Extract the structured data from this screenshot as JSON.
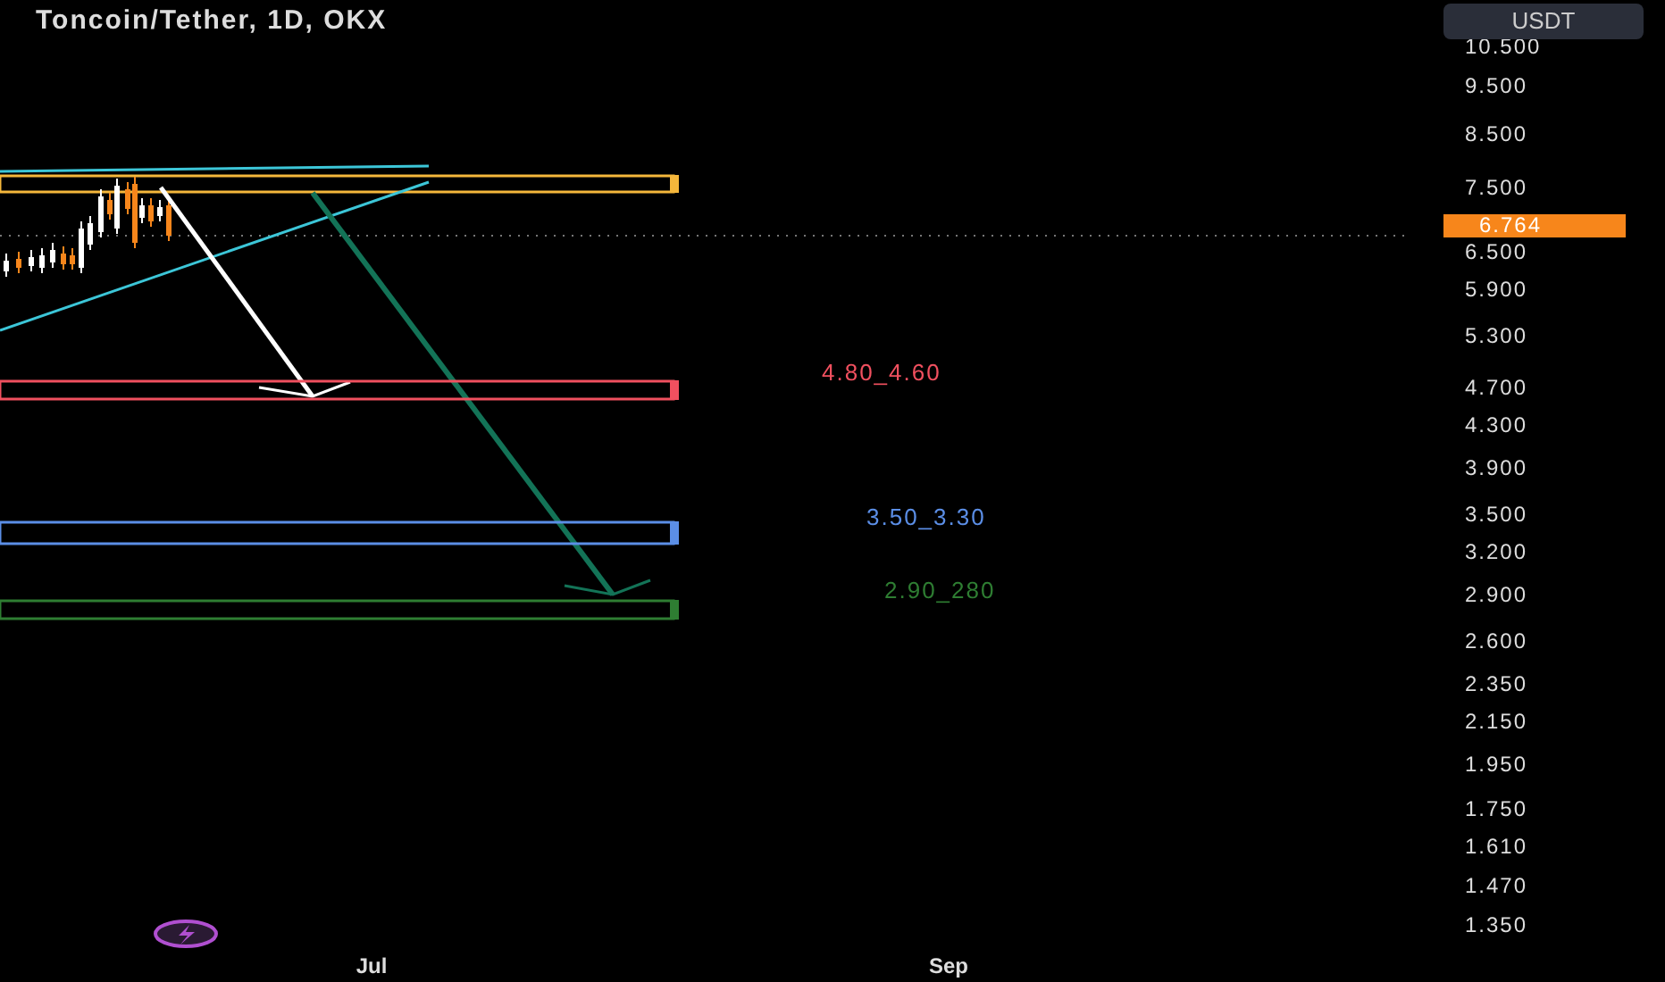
{
  "header": {
    "title": "Toncoin/Tether, 1D, OKX"
  },
  "currency_button": {
    "label": "USDT"
  },
  "price_axis": {
    "labels": [
      "10.500",
      "9.500",
      "8.500",
      "7.500",
      "6.500",
      "5.900",
      "5.300",
      "4.700",
      "4.300",
      "3.900",
      "3.500",
      "3.200",
      "2.900",
      "2.600",
      "2.350",
      "2.150",
      "1.950",
      "1.750",
      "1.610",
      "1.470",
      "1.350"
    ],
    "current_price": "6.764"
  },
  "zones": [
    {
      "label": "4.80_4.60",
      "color": "#f0505f"
    },
    {
      "label": "3.50_3.30",
      "color": "#5b8ee6"
    },
    {
      "label": "2.90_280",
      "color": "#2e7d32"
    }
  ],
  "resistance_zone": {
    "color": "#f5b73b"
  },
  "time_axis": {
    "labels": [
      "Jul",
      "Sep"
    ]
  }
}
